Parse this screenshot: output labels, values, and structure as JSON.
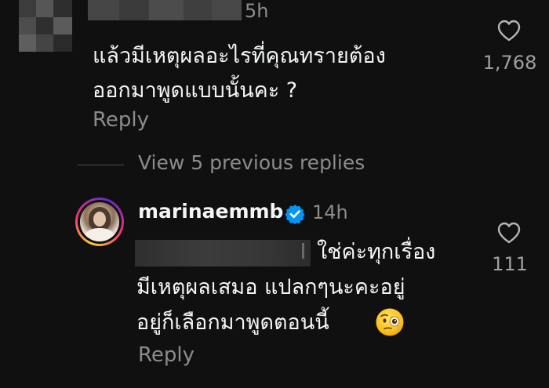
{
  "comment": {
    "time": "5h",
    "text_line1": "แล้วมีเหตุผลอะไรที่คุณทรายต้อง",
    "text_line2": "ออกมาพูดแบบนั้นคะ ?",
    "reply_label": "Reply",
    "like_count": "1,768",
    "like_icon": "heart-outline-icon"
  },
  "thread": {
    "view_replies_label": "View 5 previous replies"
  },
  "reply": {
    "username": "marinaemmb",
    "verified_icon": "verified-badge-icon",
    "time": "14h",
    "text_line1": "ใช่ค่ะทุกเรื่อง",
    "text_line2": "มีเหตุผลเสมอ แปลกๆนะคะอยู่",
    "text_line3": "อยู่ก็เลือกมาพูดตอนนี้",
    "emoji": "face-with-monocle",
    "reply_label": "Reply",
    "like_count": "111",
    "like_icon": "heart-outline-icon"
  },
  "colors": {
    "background": "#101010",
    "primary_text": "#f3f5f7",
    "secondary_text": "#8c8c8c",
    "verified_blue": "#0095f6"
  }
}
